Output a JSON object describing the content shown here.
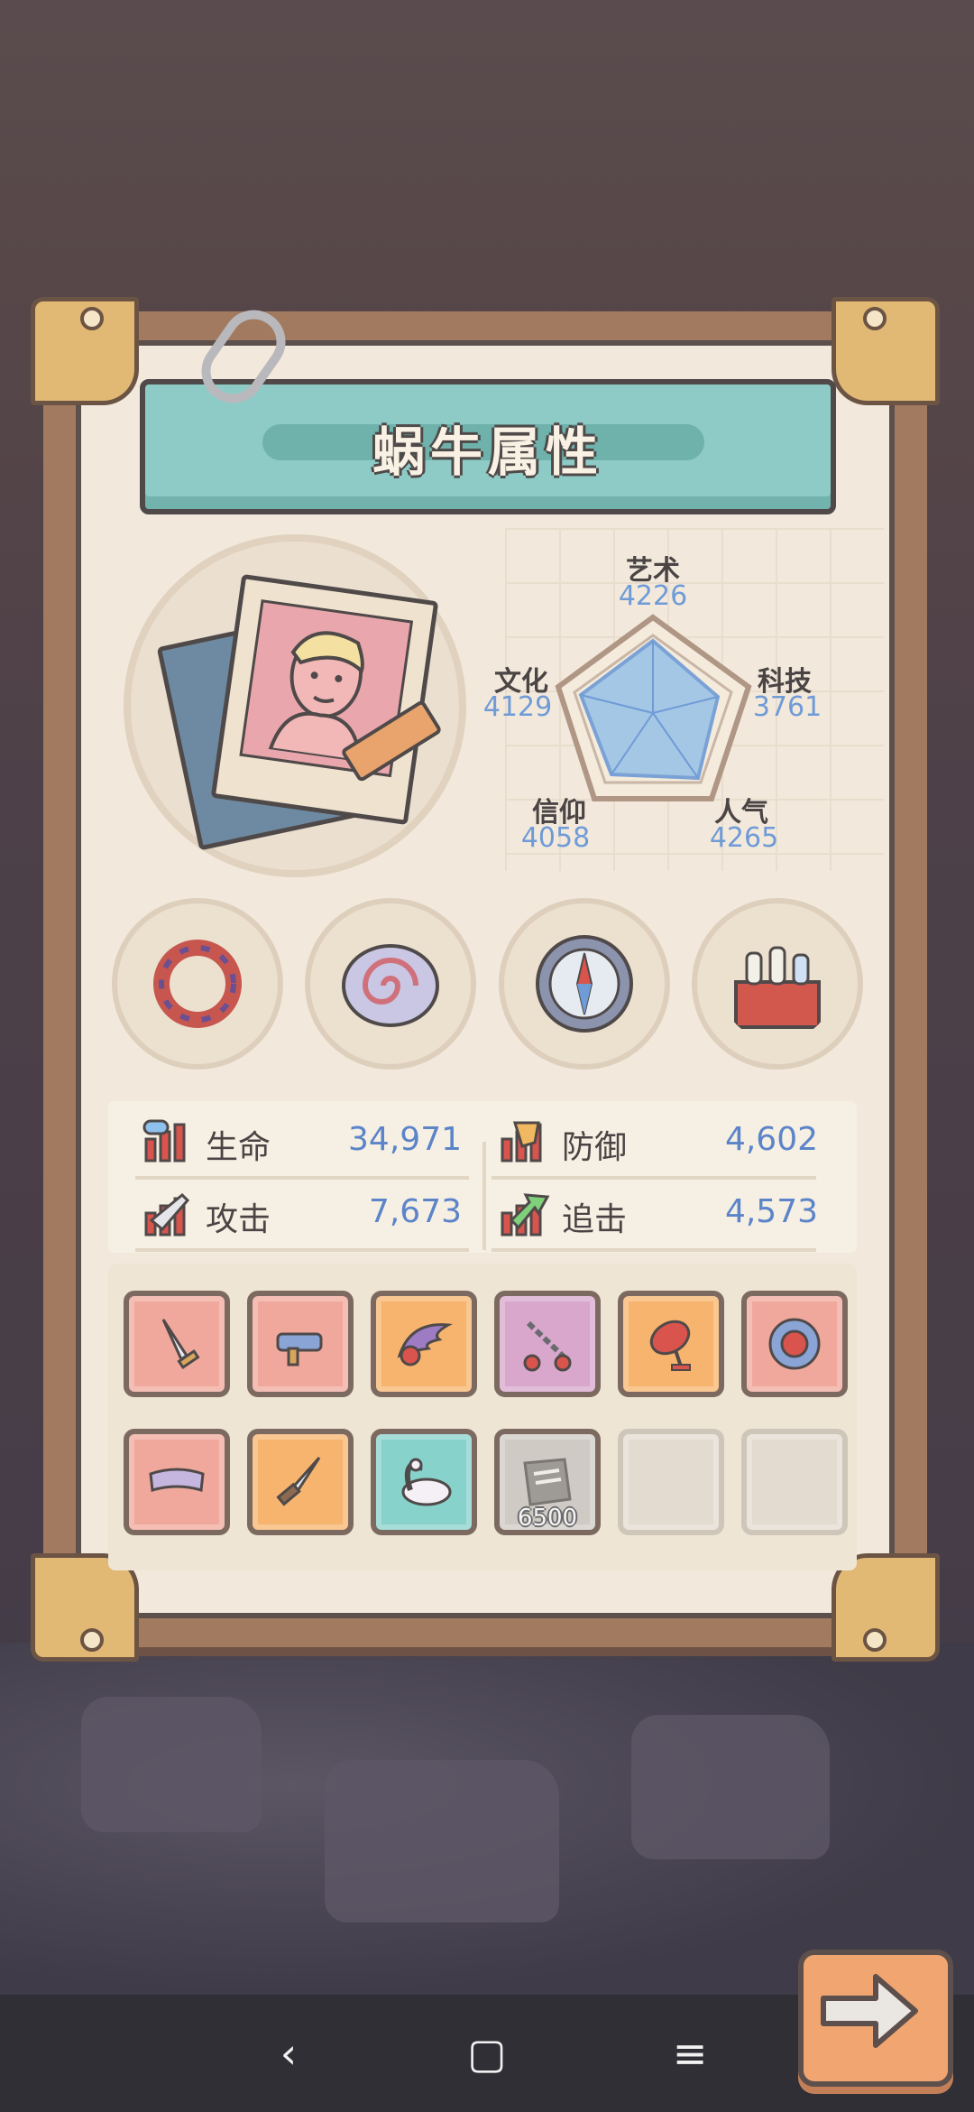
{
  "title": "蜗牛属性",
  "radar": [
    {
      "label": "艺术",
      "value": "4226"
    },
    {
      "label": "科技",
      "value": "3761"
    },
    {
      "label": "人气",
      "value": "4265"
    },
    {
      "label": "信仰",
      "value": "4058"
    },
    {
      "label": "文化",
      "value": "4129"
    }
  ],
  "equipment": [
    {
      "icon": "tentacle-ring-icon"
    },
    {
      "icon": "spiral-shell-icon"
    },
    {
      "icon": "compass-icon"
    },
    {
      "icon": "potion-crate-icon"
    }
  ],
  "stats": {
    "hp": {
      "label": "生命",
      "value": "34,971"
    },
    "defense": {
      "label": "防御",
      "value": "4,602"
    },
    "attack": {
      "label": "攻击",
      "value": "7,673"
    },
    "chase": {
      "label": "追击",
      "value": "4,573"
    }
  },
  "slots": [
    {
      "icon": "dagger-icon",
      "color": "#f0a89c"
    },
    {
      "icon": "gun-icon",
      "color": "#f0a89c"
    },
    {
      "icon": "wing-icon",
      "color": "#f6b46e"
    },
    {
      "icon": "chain-icon",
      "color": "#d9a7cc"
    },
    {
      "icon": "bomb-icon",
      "color": "#f6b46e"
    },
    {
      "icon": "shield-icon",
      "color": "#f0a89c"
    },
    {
      "icon": "headband-icon",
      "color": "#f0a89c"
    },
    {
      "icon": "knife-icon",
      "color": "#f6b46e"
    },
    {
      "icon": "swan-float-icon",
      "color": "#88d2cc"
    },
    {
      "icon": "scroll-icon",
      "color": "#cfcac4",
      "cost": "6500"
    },
    {
      "icon": "empty",
      "color": "#e3dbd0"
    },
    {
      "icon": "empty",
      "color": "#e3dbd0"
    }
  ],
  "navbar": {
    "back": "‹",
    "home": "▢",
    "menu": "≡"
  }
}
